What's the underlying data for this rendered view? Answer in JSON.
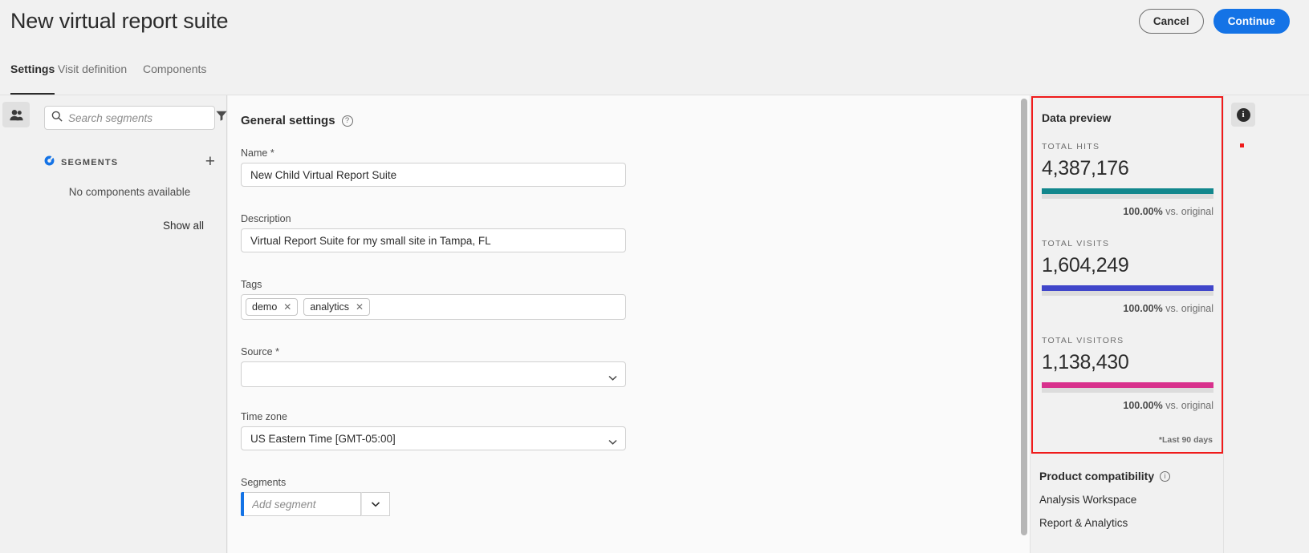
{
  "header": {
    "title": "New virtual report suite",
    "cancel_label": "Cancel",
    "continue_label": "Continue"
  },
  "tabs": [
    {
      "label": "Settings",
      "active": true
    },
    {
      "label": "Visit definition",
      "active": false
    },
    {
      "label": "Components",
      "active": false
    }
  ],
  "left_rail": {
    "icon": "users-icon"
  },
  "sidebar": {
    "search_placeholder": "Search segments",
    "search_value": "",
    "search_icon": "search-icon",
    "filter_icon": "filter-icon",
    "segments_header": "SEGMENTS",
    "segments_icon": "segment-icon",
    "add_icon": "plus-icon",
    "empty_text": "No components available",
    "show_all_label": "Show all"
  },
  "main": {
    "section_title": "General settings",
    "help_icon": "question-circle-icon",
    "name": {
      "label": "Name",
      "required": "*",
      "value": "New Child Virtual Report Suite",
      "placeholder": ""
    },
    "description": {
      "label": "Description",
      "value": "Virtual Report Suite for my small site in Tampa, FL",
      "placeholder": ""
    },
    "tags": {
      "label": "Tags",
      "items": [
        {
          "label": "demo",
          "remove_icon": "close-icon"
        },
        {
          "label": "analytics",
          "remove_icon": "close-icon"
        }
      ]
    },
    "source": {
      "label": "Source",
      "required": "*",
      "value": "",
      "chevron_icon": "chevron-down-icon"
    },
    "timezone": {
      "label": "Time zone",
      "value": "US Eastern Time [GMT-05:00]",
      "chevron_icon": "chevron-down-icon"
    },
    "segments": {
      "label": "Segments",
      "placeholder": "Add segment",
      "value": "",
      "chevron_icon": "chevron-down-icon"
    }
  },
  "data_preview": {
    "title": "Data preview",
    "footnote": "*Last 90 days",
    "metrics": [
      {
        "label": "TOTAL HITS",
        "value": "4,387,176",
        "comparison_pct": "100.00%",
        "comparison_text": "vs. original",
        "bar_color": "#12878d",
        "bar_pct": 100
      },
      {
        "label": "TOTAL VISITS",
        "value": "1,604,249",
        "comparison_pct": "100.00%",
        "comparison_text": "vs. original",
        "bar_color": "#4046ca",
        "bar_pct": 100
      },
      {
        "label": "TOTAL VISITORS",
        "value": "1,138,430",
        "comparison_pct": "100.00%",
        "comparison_text": "vs. original",
        "bar_color": "#d8318d",
        "bar_pct": 100
      }
    ],
    "highlight_color": "#ef1b1b"
  },
  "product_compatibility": {
    "title": "Product compatibility",
    "info_icon": "info-circle-icon",
    "items": [
      {
        "label": "Analysis Workspace"
      },
      {
        "label": "Report & Analytics"
      }
    ]
  },
  "far_rail": {
    "info_icon": "info-filled-icon",
    "marker_color": "#ef1b1b"
  }
}
